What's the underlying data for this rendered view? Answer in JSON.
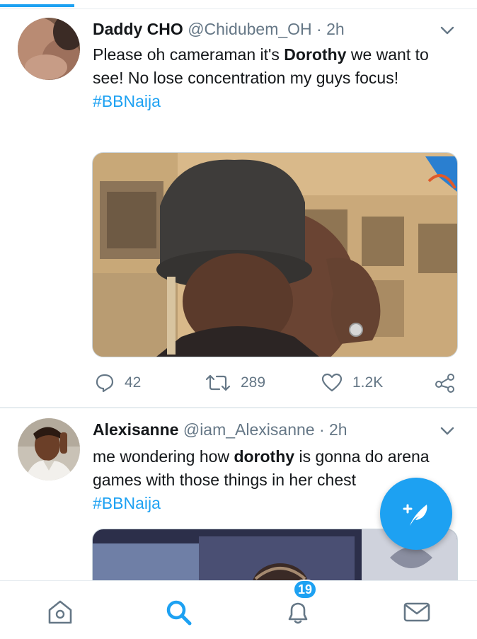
{
  "tweets": [
    {
      "name": "Daddy CHO",
      "handle": "@Chidubem_OH",
      "sep": " · ",
      "time": "2h",
      "text_before": "Please oh cameraman it's ",
      "text_bold": "Dorothy",
      "text_after": " we want to see! No lose concentration my guys focus!",
      "hashtag": "#BBNaija",
      "replies": "42",
      "retweets": "289",
      "likes": "1.2K"
    },
    {
      "name": "Alexisanne",
      "handle": "@iam_Alexisanne",
      "sep": " · ",
      "time": "2h",
      "text_before": "me wondering how ",
      "text_bold": "dorothy",
      "text_after": " is gonna do arena games with those things in her chest",
      "hashtag": "#BBNaija"
    }
  ],
  "nav": {
    "notifications_badge": "19"
  },
  "icons": {
    "caret": "chevron-down-icon",
    "reply": "reply-icon",
    "retweet": "retweet-icon",
    "like": "heart-icon",
    "share": "share-icon",
    "compose": "compose-feather-icon",
    "home": "home-icon",
    "search": "search-icon",
    "notifications": "bell-icon",
    "messages": "mail-icon"
  },
  "colors": {
    "accent": "#1da1f2",
    "text": "#14171a",
    "secondary": "#657786"
  }
}
